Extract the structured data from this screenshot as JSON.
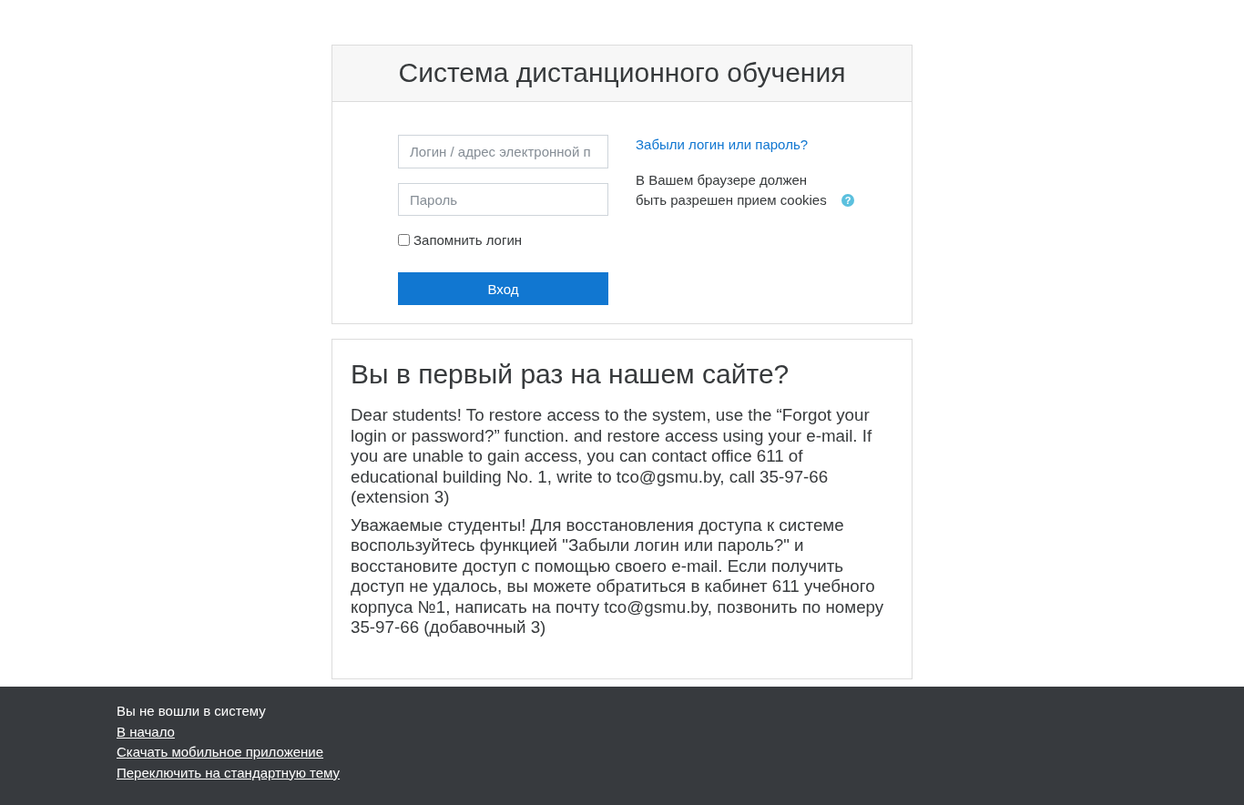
{
  "login_card": {
    "title": "Система дистанционного обучения",
    "username": {
      "placeholder": "Логин / адрес электронной п"
    },
    "password": {
      "placeholder": "Пароль"
    },
    "remember": {
      "label": "Запомнить логин",
      "checked": false
    },
    "submit": "Вход",
    "forgot_link": "Забыли логин или пароль?",
    "cookies_note": "В Вашем браузере должен быть разрешен прием cookies",
    "help_icon": "?"
  },
  "info_card": {
    "title": "Вы в первый раз на нашем сайте?",
    "paragraphs": [
      "Dear students! To restore access to the system, use the “Forgot your login or password?” function. and restore access using your e-mail. If you are unable to gain access, you can contact office 611 of educational building No. 1, write to tco@gsmu.by, call 35-97-66 (extension 3)",
      "Уважаемые студенты! Для восстановления доступа к системе воспользуйтесь функцией \"Забыли логин или пароль?\" и восстановите доступ с помощью своего e-mail. Если получить доступ не удалось, вы можете обратиться в кабинет 611 учебного корпуса №1, написать на почту tco@gsmu.by, позвонить по номеру 35-97-66 (добавочный 3)"
    ]
  },
  "footer": {
    "status": "Вы не вошли в систему",
    "links": [
      "В начало",
      "Скачать мобильное приложение",
      "Переключить на стандартную тему"
    ]
  }
}
